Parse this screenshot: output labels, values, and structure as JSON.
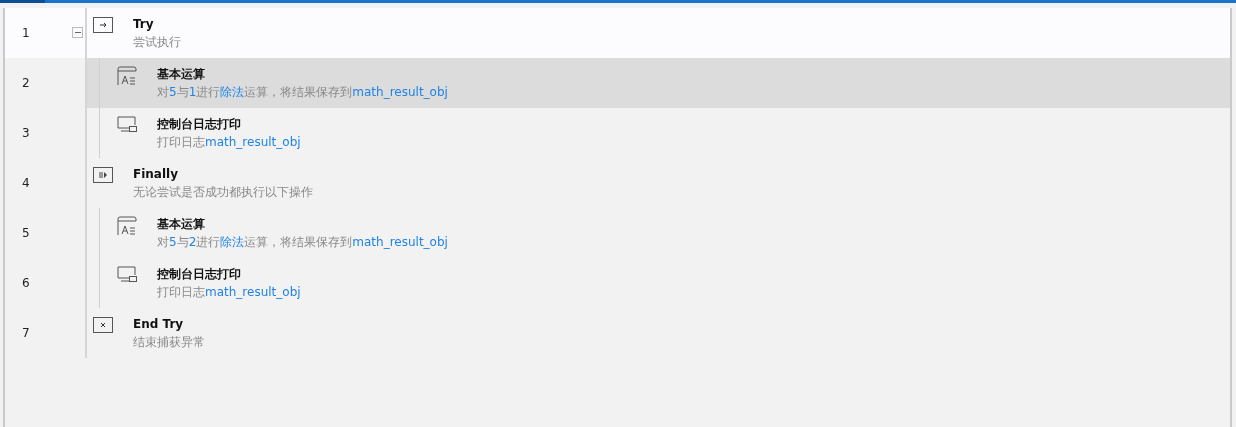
{
  "tab": {
    "selected": true
  },
  "steps": [
    {
      "number": "1",
      "kind": "try",
      "title": "Try",
      "expanded": true,
      "hovered": true,
      "selected": false,
      "description": [
        {
          "text": "尝试执行",
          "highlight": false
        }
      ],
      "children": [
        {
          "number": "2",
          "kind": "math",
          "title": "基本运算",
          "hovered": false,
          "selected": true,
          "description": [
            {
              "text": "对",
              "highlight": false
            },
            {
              "text": "5",
              "highlight": true
            },
            {
              "text": "与",
              "highlight": false
            },
            {
              "text": "1",
              "highlight": true
            },
            {
              "text": "进行",
              "highlight": false
            },
            {
              "text": "除法",
              "highlight": true
            },
            {
              "text": "运算，将结果保存到",
              "highlight": false
            },
            {
              "text": "math_result_obj",
              "highlight": true
            }
          ]
        },
        {
          "number": "3",
          "kind": "console",
          "title": "控制台日志打印",
          "hovered": false,
          "selected": false,
          "description": [
            {
              "text": "打印日志",
              "highlight": false
            },
            {
              "text": "math_result_obj",
              "highlight": true
            }
          ]
        }
      ]
    },
    {
      "number": "4",
      "kind": "finally",
      "title": "Finally",
      "hovered": false,
      "selected": false,
      "description": [
        {
          "text": "无论尝试是否成功都执行以下操作",
          "highlight": false
        }
      ],
      "children": [
        {
          "number": "5",
          "kind": "math",
          "title": "基本运算",
          "hovered": false,
          "selected": false,
          "description": [
            {
              "text": "对",
              "highlight": false
            },
            {
              "text": "5",
              "highlight": true
            },
            {
              "text": "与",
              "highlight": false
            },
            {
              "text": "2",
              "highlight": true
            },
            {
              "text": "进行",
              "highlight": false
            },
            {
              "text": "除法",
              "highlight": true
            },
            {
              "text": "运算，将结果保存到",
              "highlight": false
            },
            {
              "text": "math_result_obj",
              "highlight": true
            }
          ]
        },
        {
          "number": "6",
          "kind": "console",
          "title": "控制台日志打印",
          "hovered": false,
          "selected": false,
          "description": [
            {
              "text": "打印日志",
              "highlight": false
            },
            {
              "text": "math_result_obj",
              "highlight": true
            }
          ]
        }
      ]
    },
    {
      "number": "7",
      "kind": "endtry",
      "title": "End Try",
      "hovered": false,
      "selected": false,
      "description": [
        {
          "text": "结束捕获异常",
          "highlight": false
        }
      ]
    }
  ]
}
